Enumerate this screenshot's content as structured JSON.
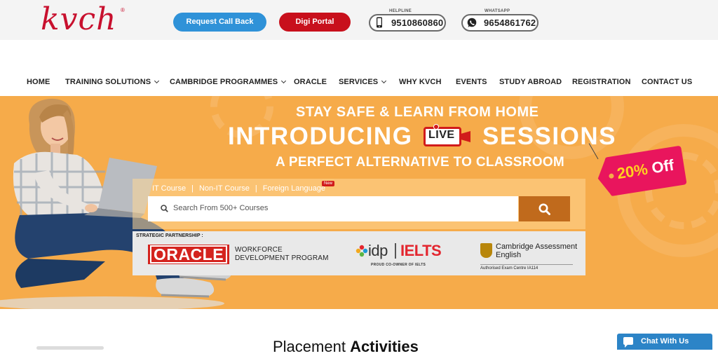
{
  "header": {
    "logo_text": "kvch",
    "logo_mark": "®",
    "request_call_back": "Request Call Back",
    "digi_portal": "Digi Portal",
    "helpline_caption": "HELPLINE",
    "helpline_number": "9510860860",
    "whatsapp_caption": "WHATSAPP",
    "whatsapp_number": "9654861762"
  },
  "nav": {
    "items": [
      {
        "label": "HOME",
        "dropdown": false
      },
      {
        "label": "TRAINING SOLUTIONS",
        "dropdown": true
      },
      {
        "label": "CAMBRIDGE PROGRAMMES",
        "dropdown": true
      },
      {
        "label": "ORACLE",
        "dropdown": false
      },
      {
        "label": "SERVICES",
        "dropdown": true
      },
      {
        "label": "WHY KVCH",
        "dropdown": false
      },
      {
        "label": "EVENTS",
        "dropdown": false
      },
      {
        "label": "STUDY ABROAD",
        "dropdown": false
      },
      {
        "label": "REGISTRATION",
        "dropdown": false
      },
      {
        "label": "CONTACT US",
        "dropdown": false
      }
    ]
  },
  "hero": {
    "line1": "STAY SAFE & LEARN FROM HOME",
    "line2a": "INTRODUCING",
    "live_label": "LIVE",
    "line2b": "SESSIONS",
    "line3": "A PERFECT ALTERNATIVE TO CLASSROOM",
    "offer_value": "20%",
    "offer_word": "Off",
    "tabs": [
      "IT Course",
      "Non-IT Course",
      "Foreign Language"
    ],
    "tab_separator": "|",
    "new_badge": "New",
    "search_placeholder": "Search From 500+ Courses"
  },
  "partnership": {
    "caption": "STRATEGIC PARTNERSHIP :",
    "oracle": "ORACLE",
    "oracle_program_line1": "WORKFORCE",
    "oracle_program_line2": "DEVELOPMENT PROGRAM",
    "idp": "idp",
    "ielts": "IELTS",
    "idp_sub": "PROUD CO-OWNER OF IELTS",
    "cambridge_line1": "Cambridge Assessment",
    "cambridge_line2": "English",
    "cambridge_sub": "Authorised Exam Centre IA114"
  },
  "section": {
    "title_regular": "Placement ",
    "title_bold": "Activities"
  },
  "chat": {
    "label": "Chat With Us"
  },
  "colors": {
    "brand_red": "#c8102e",
    "hero_orange": "#f6ab4a",
    "call_blue": "#2f92d8",
    "digi_red": "#c8101c",
    "tag_pink": "#e9155d",
    "search_button": "#c06a1c",
    "chat_blue": "#2c84c7"
  }
}
